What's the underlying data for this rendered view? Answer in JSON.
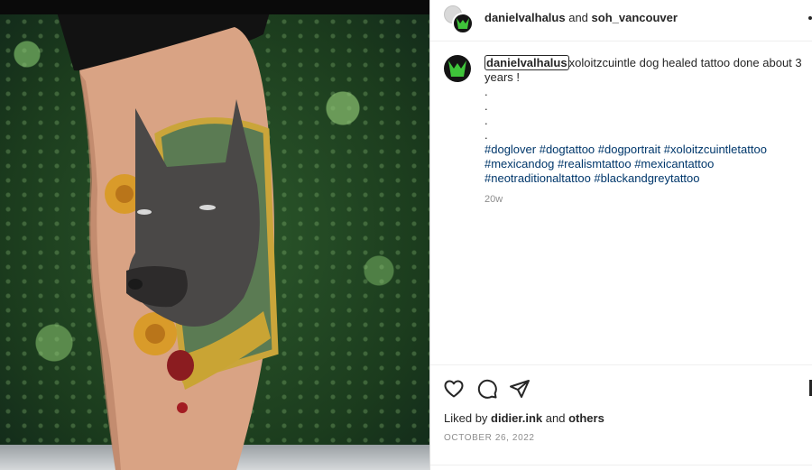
{
  "header": {
    "author": "danielvalhalus",
    "joiner": "and",
    "coauthor": "soh_vancouver",
    "more_icon": "ellipsis-icon"
  },
  "caption": {
    "username": "danielvalhalus",
    "text": "xoloitzcuintle dog healed tattoo done about 3 years !",
    "dots": [
      ".",
      ".",
      ".",
      "."
    ],
    "hashtags": "#doglover #dogtattoo #dogportrait #xoloitzcuintletattoo #mexicandog #realismtattoo #mexicantattoo #neotraditionaltattoo #blackandgreytattoo",
    "time": "20w"
  },
  "actions": {
    "icons": [
      "heart-icon",
      "comment-icon",
      "share-icon",
      "bookmark-icon"
    ]
  },
  "likes": {
    "prefix": "Liked by",
    "user": "didier.ink",
    "joiner": "and",
    "others": "others"
  },
  "date": "OCTOBER 26, 2022",
  "colors": {
    "text": "#262626",
    "hashtag": "#00376b",
    "muted": "#8e8e8e",
    "border": "#dbdbdb"
  }
}
